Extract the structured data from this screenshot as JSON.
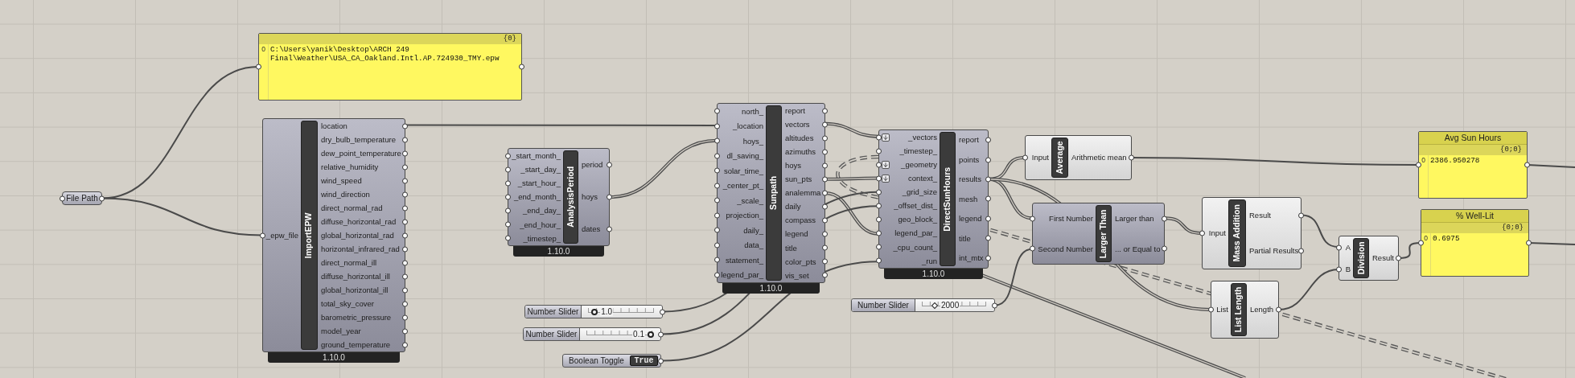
{
  "nodes": [
    {
      "kind": "panel",
      "path": "{0}",
      "items": [
        {
          "index": "0",
          "value": "C:\\Users\\yanik\\Desktop\\ARCH 249 Final\\Weather\\USA_CA_Oakland.Intl.AP.724930_TMY.epw"
        }
      ]
    },
    {
      "kind": "param",
      "label": "File Path"
    },
    {
      "kind": "component",
      "name": "ImportEPW",
      "version": "1.10.0",
      "preview": true,
      "inputs": [
        {
          "label": "_epw_file"
        }
      ],
      "outputs": [
        {
          "label": "location"
        },
        {
          "label": "dry_bulb_temperature"
        },
        {
          "label": "dew_point_temperature"
        },
        {
          "label": "relative_humidity"
        },
        {
          "label": "wind_speed"
        },
        {
          "label": "wind_direction"
        },
        {
          "label": "direct_normal_rad"
        },
        {
          "label": "diffuse_horizontal_rad"
        },
        {
          "label": "global_horizontal_rad"
        },
        {
          "label": "horizontal_infrared_rad"
        },
        {
          "label": "direct_normal_ill"
        },
        {
          "label": "diffuse_horizontal_ill"
        },
        {
          "label": "global_horizontal_ill"
        },
        {
          "label": "total_sky_cover"
        },
        {
          "label": "barometric_pressure"
        },
        {
          "label": "model_year"
        },
        {
          "label": "ground_temperature"
        }
      ]
    },
    {
      "kind": "component",
      "name": "AnalysisPeriod",
      "version": "1.10.0",
      "preview": true,
      "inputs": [
        {
          "label": "_start_month_"
        },
        {
          "label": "_start_day_"
        },
        {
          "label": "_start_hour_"
        },
        {
          "label": "_end_month_"
        },
        {
          "label": "_end_day_"
        },
        {
          "label": "_end_hour_"
        },
        {
          "label": "_timestep_"
        }
      ],
      "outputs": [
        {
          "label": "period"
        },
        {
          "label": "hoys"
        },
        {
          "label": "dates"
        }
      ]
    },
    {
      "kind": "component",
      "name": "Sunpath",
      "version": "1.10.0",
      "preview": true,
      "inputs": [
        {
          "label": "north_"
        },
        {
          "label": "_location"
        },
        {
          "label": "hoys_"
        },
        {
          "label": "dl_saving_"
        },
        {
          "label": "solar_time_"
        },
        {
          "label": "_center_pt_"
        },
        {
          "label": "_scale_"
        },
        {
          "label": "projection_"
        },
        {
          "label": "daily_"
        },
        {
          "label": "data_"
        },
        {
          "label": "statement_"
        },
        {
          "label": "legend_par_"
        }
      ],
      "outputs": [
        {
          "label": "report"
        },
        {
          "label": "vectors"
        },
        {
          "label": "altitudes"
        },
        {
          "label": "azimuths"
        },
        {
          "label": "hoys"
        },
        {
          "label": "sun_pts"
        },
        {
          "label": "analemma"
        },
        {
          "label": "daily"
        },
        {
          "label": "compass"
        },
        {
          "label": "legend"
        },
        {
          "label": "title"
        },
        {
          "label": "color_pts"
        },
        {
          "label": "vis_set"
        }
      ]
    },
    {
      "kind": "float_slider",
      "label": "Number Slider",
      "value": "1.0"
    },
    {
      "kind": "float_slider",
      "label": "Number Slider",
      "value": "0.1"
    },
    {
      "kind": "toggle",
      "label": "Boolean Toggle",
      "value": "True"
    },
    {
      "kind": "component",
      "name": "DirectSunHours",
      "version": "1.10.0",
      "preview": true,
      "inputs": [
        {
          "label": "_vectors",
          "flatten": true
        },
        {
          "label": "_timestep_",
          "flatten": false
        },
        {
          "label": "_geometry",
          "flatten": true
        },
        {
          "label": "context_",
          "flatten": true
        },
        {
          "label": "_grid_size",
          "flatten": false
        },
        {
          "label": "_offset_dist_",
          "flatten": false
        },
        {
          "label": "geo_block_",
          "flatten": false
        },
        {
          "label": "legend_par_",
          "flatten": false
        },
        {
          "label": "_cpu_count_",
          "flatten": false
        },
        {
          "label": "_run",
          "flatten": false
        }
      ],
      "outputs": [
        {
          "label": "report"
        },
        {
          "label": "points"
        },
        {
          "label": "results"
        },
        {
          "label": "mesh"
        },
        {
          "label": "legend"
        },
        {
          "label": "title"
        },
        {
          "label": "int_mtx"
        }
      ]
    },
    {
      "kind": "integer_slider",
      "label": "Number Slider",
      "value": "2000"
    },
    {
      "kind": "component",
      "name": "Average",
      "preview": false,
      "inputs": [
        {
          "label": "Input"
        }
      ],
      "outputs": [
        {
          "label": "Arithmetic mean"
        }
      ]
    },
    {
      "kind": "panel",
      "title": "Avg Sun Hours",
      "path": "{0;0}",
      "items": [
        {
          "index": "0",
          "value": "2386.950278"
        }
      ]
    },
    {
      "kind": "component",
      "name": "Larger Than",
      "preview": true,
      "inputs": [
        {
          "label": "First Number"
        },
        {
          "label": "Second Number"
        }
      ],
      "outputs": [
        {
          "label": "Larger than"
        },
        {
          "label": "... or Equal to"
        }
      ]
    },
    {
      "kind": "component",
      "name": "Mass Addition",
      "preview": false,
      "inputs": [
        {
          "label": "Input"
        }
      ],
      "outputs": [
        {
          "label": "Result"
        },
        {
          "label": "Partial Results"
        }
      ]
    },
    {
      "kind": "component",
      "name": "List Length",
      "preview": false,
      "inputs": [
        {
          "label": "List"
        }
      ],
      "outputs": [
        {
          "label": "Length"
        }
      ]
    },
    {
      "kind": "component",
      "name": "Division",
      "preview": false,
      "inputs": [
        {
          "label": "A"
        },
        {
          "label": "B"
        }
      ],
      "outputs": [
        {
          "label": "Result"
        }
      ]
    },
    {
      "kind": "panel",
      "title": "% Well-Lit",
      "path": "{0;0}",
      "items": [
        {
          "index": "0",
          "value": "0.6975"
        }
      ]
    }
  ]
}
